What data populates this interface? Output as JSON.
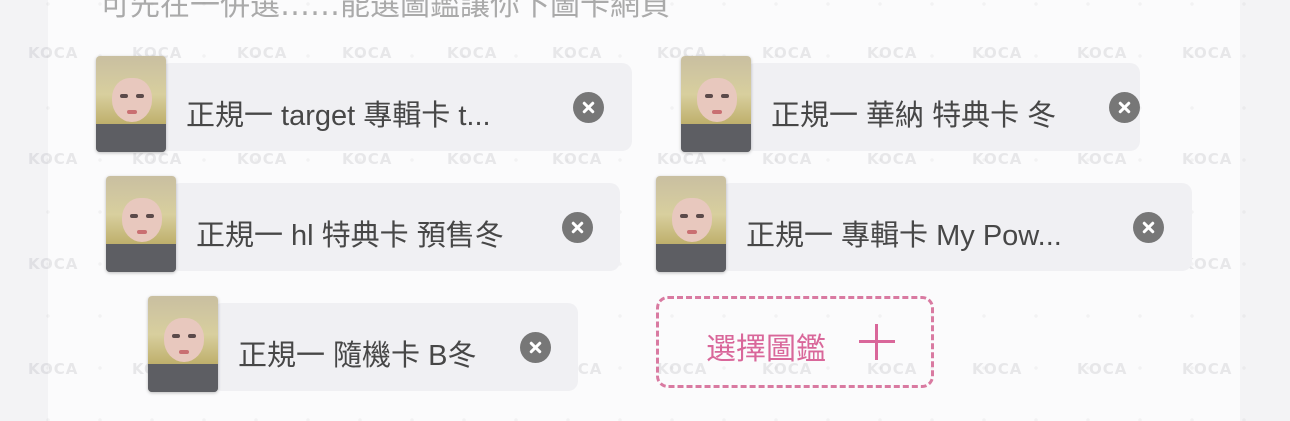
{
  "header": {
    "partial_text": "可先在一併選……能選圖鑑讓你下圖卡網頁"
  },
  "chips": [
    {
      "label": "正規一 target 專輯卡 t...",
      "remove_icon": "close-circle-icon"
    },
    {
      "label": "正規一 華納 特典卡 冬",
      "remove_icon": "close-circle-icon"
    },
    {
      "label": "正規一 hl 特典卡 預售冬",
      "remove_icon": "close-circle-icon"
    },
    {
      "label": "正規一 專輯卡 My Pow...",
      "remove_icon": "close-circle-icon"
    },
    {
      "label": "正規一 隨機卡 B冬",
      "remove_icon": "close-circle-icon"
    }
  ],
  "select_button": {
    "label": "選擇圖鑑",
    "icon": "plus-icon"
  },
  "watermark": "KOCA",
  "colors": {
    "accent": "#d9679a",
    "chip_bg": "#f0f0f3",
    "remove_icon": "#777777",
    "text": "#474747"
  }
}
